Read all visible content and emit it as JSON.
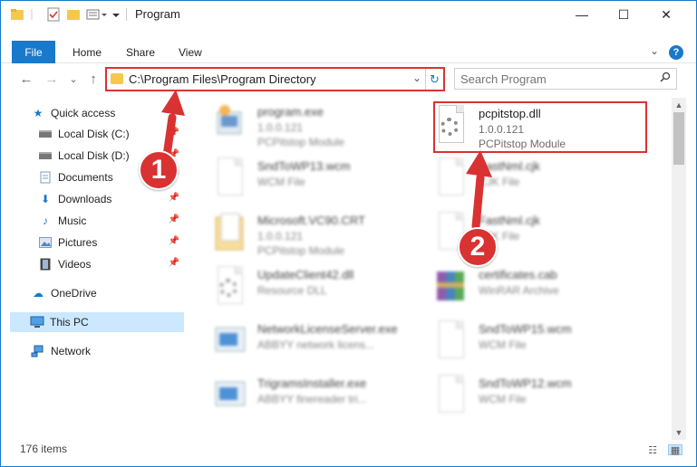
{
  "window": {
    "title": "Program",
    "controls": {
      "minimize": "—",
      "maximize": "☐",
      "close": "✕"
    }
  },
  "ribbon": {
    "tabs": [
      "File",
      "Home",
      "Share",
      "View"
    ],
    "expand": "⌄",
    "help": "?"
  },
  "address": {
    "path": "C:\\Program Files\\Program Directory",
    "dropdown": "⌄",
    "refresh": "↻"
  },
  "search": {
    "placeholder": "Search Program",
    "icon": "magnifier-icon"
  },
  "nav": {
    "back": "←",
    "forward": "→",
    "recent": "⌄",
    "up": "↑",
    "items": [
      {
        "label": "Quick access",
        "icon": "star-icon"
      },
      {
        "label": "Local Disk (C:)",
        "icon": "drive-icon"
      },
      {
        "label": "Local Disk (D:)",
        "icon": "drive-icon"
      },
      {
        "label": "Documents",
        "icon": "documents-icon"
      },
      {
        "label": "Downloads",
        "icon": "download-icon"
      },
      {
        "label": "Music",
        "icon": "music-icon"
      },
      {
        "label": "Pictures",
        "icon": "pictures-icon"
      },
      {
        "label": "Videos",
        "icon": "videos-icon"
      },
      {
        "label": "OneDrive",
        "icon": "cloud-icon"
      },
      {
        "label": "This PC",
        "icon": "computer-icon"
      },
      {
        "label": "Network",
        "icon": "network-icon"
      }
    ]
  },
  "files": [
    {
      "name": "program.exe",
      "line1": "1.0.0.121",
      "line2": "PCPitstop Module"
    },
    {
      "name": "pcpitstop.dll",
      "line1": "1.0.0.121",
      "line2": "PCPitstop Module"
    },
    {
      "name": "SndToWP13.wcm",
      "line1": "WCM File",
      "line2": ""
    },
    {
      "name": "FastNml.cjk",
      "line1": "CJK File",
      "line2": ""
    },
    {
      "name": "Microsoft.VC90.CRT",
      "line1": "1.0.0.121",
      "line2": "PCPitstop Module"
    },
    {
      "name": "FastNml.cjk",
      "line1": "CJK File",
      "line2": ""
    },
    {
      "name": "UpdateClient42.dll",
      "line1": "Resource DLL",
      "line2": ""
    },
    {
      "name": "certificates.cab",
      "line1": "WinRAR Archive",
      "line2": ""
    },
    {
      "name": "NetworkLicenseServer.exe",
      "line1": "ABBYY network licens...",
      "line2": ""
    },
    {
      "name": "SndToWP15.wcm",
      "line1": "WCM File",
      "line2": ""
    },
    {
      "name": "TrigramsInstaller.exe",
      "line1": "ABBYY finereader tri...",
      "line2": ""
    },
    {
      "name": "SndToWP12.wcm",
      "line1": "WCM File",
      "line2": ""
    }
  ],
  "status": {
    "count": "176 items"
  },
  "annotations": {
    "step1": "1",
    "step2": "2"
  },
  "colors": {
    "accent": "#1979ca",
    "highlight": "#d93232",
    "selected": "#cce8ff"
  }
}
